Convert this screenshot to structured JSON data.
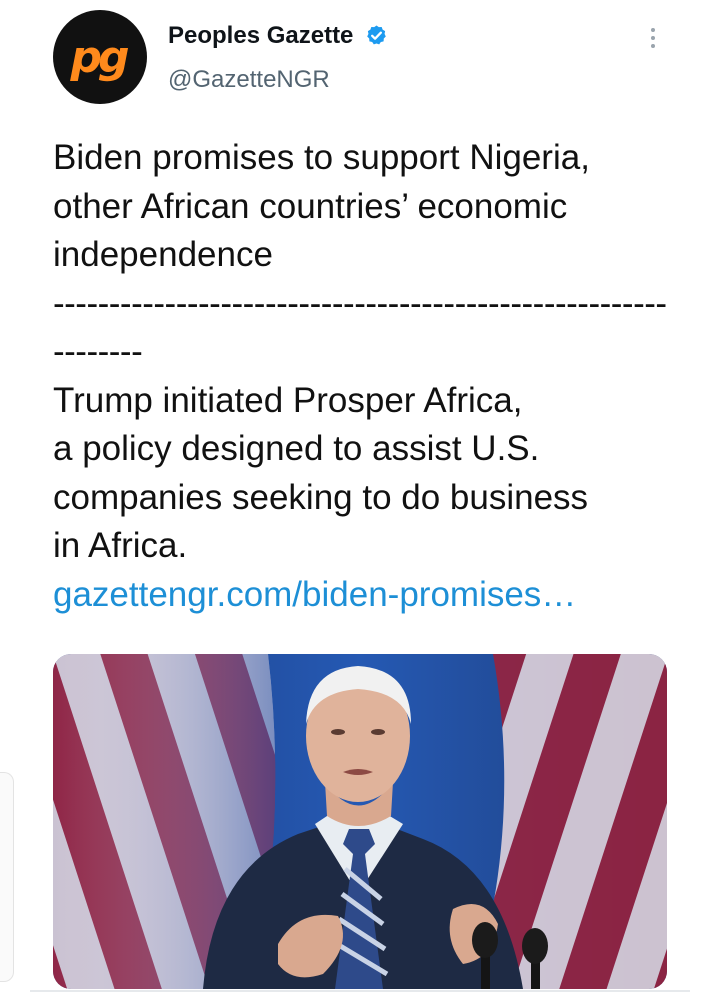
{
  "tweet": {
    "avatar_text": "pg",
    "display_name": "Peoples Gazette",
    "handle": "@GazetteNGR",
    "headline": "Biden promises to support Nigeria,\nother African countries’ economic\nindependence",
    "divider_line1": "-------------------------------------------------------",
    "divider_line2": "--------",
    "body": "Trump initiated Prosper Africa,\na policy designed to assist U.S.\ncompanies seeking to do business\nin Africa.",
    "link": "gazettengr.com/biden-promises…"
  },
  "colors": {
    "brand_orange": "#ff8a1c",
    "link_blue": "#1d8fd6",
    "verified_blue": "#1d9bf0",
    "text": "#111111",
    "muted": "#536471"
  },
  "icons": {
    "verified": "verified-badge-icon",
    "more": "more-vertical-icon"
  }
}
